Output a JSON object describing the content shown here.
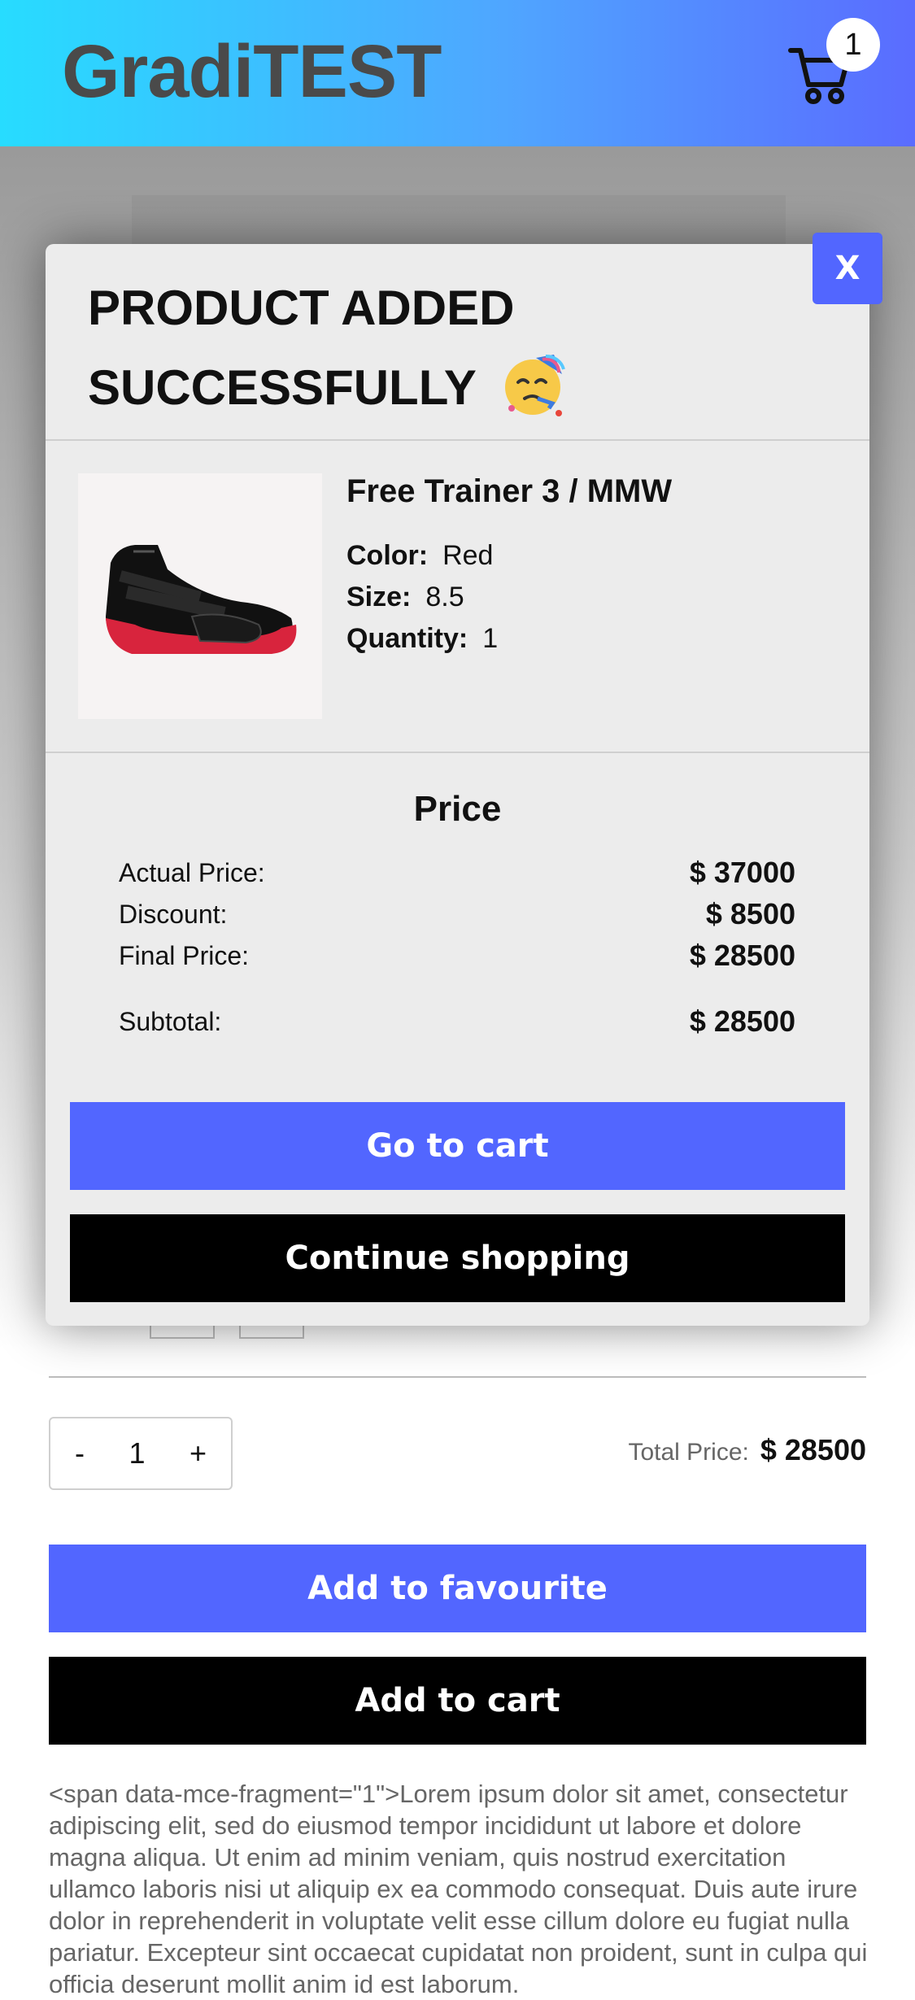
{
  "header": {
    "logo": "GradiTEST",
    "cart_count": "1"
  },
  "colors": {
    "accent_blue": "#5266ff",
    "header_gradient_start": "#27dcff",
    "header_gradient_end": "#5a6cff",
    "black_button": "#000000"
  },
  "modal": {
    "close_label": "X",
    "title_line1": "PRODUCT ADDED",
    "title_line2": "SUCCESSFULLY",
    "title_emoji": "partying-face-icon",
    "product": {
      "name": "Free Trainer 3 / MMW",
      "color_label": "Color:",
      "color_value": "Red",
      "size_label": "Size:",
      "size_value": "8.5",
      "quantity_label": "Quantity:",
      "quantity_value": "1"
    },
    "price": {
      "heading": "Price",
      "actual_label": "Actual Price:",
      "actual_value": "$ 37000",
      "discount_label": "Discount:",
      "discount_value": "$ 8500",
      "final_label": "Final Price:",
      "final_value": "$ 28500",
      "subtotal_label": "Subtotal:",
      "subtotal_value": "$ 28500"
    },
    "go_to_cart_label": "Go to cart",
    "continue_label": "Continue shopping"
  },
  "page": {
    "qty_minus": "-",
    "qty_value": "1",
    "qty_plus": "+",
    "total_label": "Total Price:",
    "total_value": "$ 28500",
    "add_favourite_label": "Add to favourite",
    "add_cart_label": "Add to cart",
    "description": "<span data-mce-fragment=\"1\">Lorem ipsum dolor sit amet, consectetur adipiscing elit, sed do eiusmod tempor incididunt ut labore et dolore magna aliqua. Ut enim ad minim veniam, quis nostrud exercitation ullamco laboris nisi ut aliquip ex ea commodo consequat. Duis aute irure dolor in reprehenderit in voluptate velit esse cillum dolore eu fugiat nulla pariatur. Excepteur sint occaecat cupidatat non proident, sunt in culpa qui officia deserunt mollit anim id est laborum."
  }
}
